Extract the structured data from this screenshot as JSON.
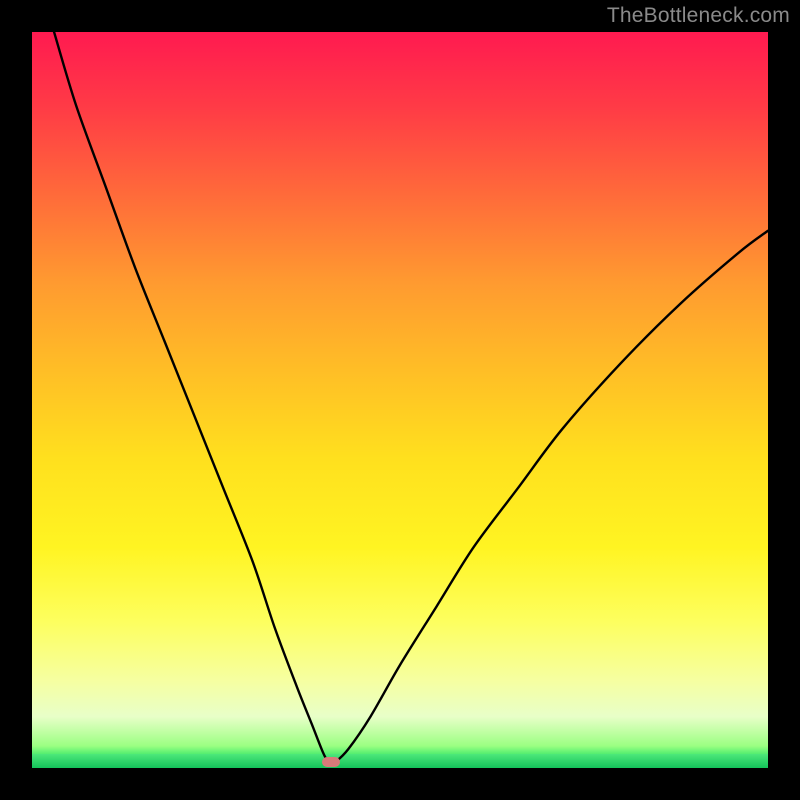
{
  "watermark": {
    "text": "TheBottleneck.com"
  },
  "colors": {
    "background": "#000000",
    "curve": "#000000",
    "marker": "#d97a7a",
    "gradient_top": "#ff1a50",
    "gradient_bottom": "#0fbf54"
  },
  "chart_data": {
    "type": "line",
    "title": "",
    "xlabel": "",
    "ylabel": "",
    "xlim": [
      0,
      100
    ],
    "ylim": [
      0,
      100
    ],
    "grid": false,
    "legend": false,
    "series": [
      {
        "name": "bottleneck-curve",
        "x": [
          3,
          6,
          10,
          14,
          18,
          22,
          26,
          30,
          33,
          36,
          38,
          39.5,
          40.2,
          40.6,
          41.3,
          43,
          46,
          50,
          55,
          60,
          66,
          72,
          80,
          88,
          96,
          100
        ],
        "y": [
          100,
          90,
          79,
          68,
          58,
          48,
          38,
          28,
          19,
          11,
          6,
          2.2,
          0.9,
          0.8,
          0.9,
          2.6,
          7,
          14,
          22,
          30,
          38,
          46,
          55,
          63,
          70,
          73
        ]
      }
    ],
    "marker": {
      "x": 40.6,
      "y": 0.8,
      "shape": "rounded-rect"
    },
    "background_gradient": {
      "direction": "vertical",
      "stops": [
        {
          "pos": 0.0,
          "color": "#ff1a50"
        },
        {
          "pos": 0.22,
          "color": "#ff6a3a"
        },
        {
          "pos": 0.46,
          "color": "#ffbe26"
        },
        {
          "pos": 0.7,
          "color": "#fff422"
        },
        {
          "pos": 0.88,
          "color": "#f6ffa0"
        },
        {
          "pos": 0.99,
          "color": "#18e060"
        },
        {
          "pos": 1.0,
          "color": "#0fbf54"
        }
      ]
    }
  }
}
